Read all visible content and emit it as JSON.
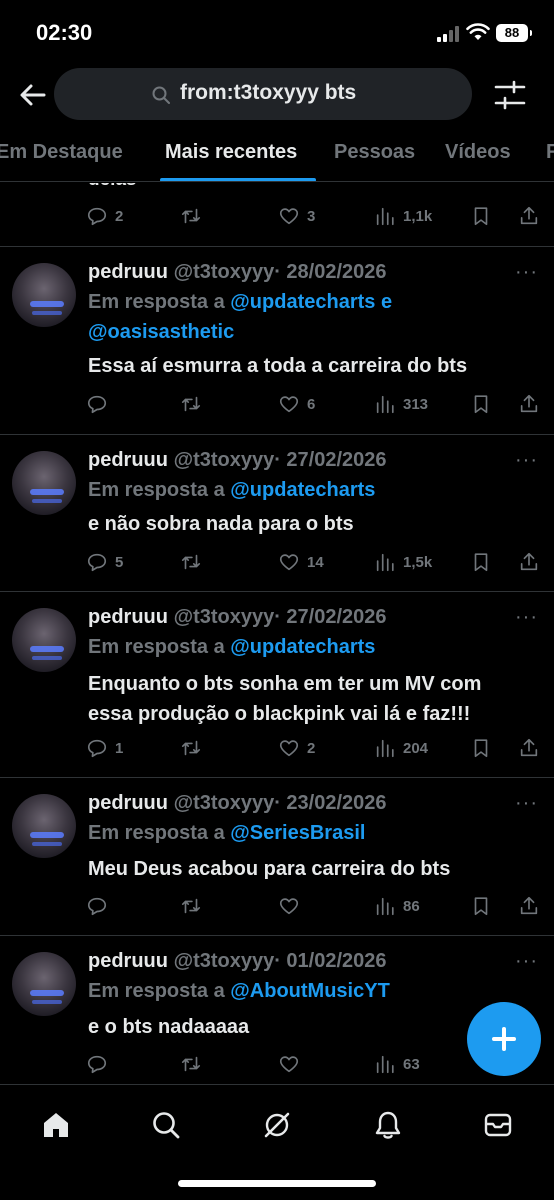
{
  "status_bar": {
    "time": "02:30",
    "battery": "88"
  },
  "search": {
    "query": "from:t3toxyyy bts"
  },
  "tabs": [
    {
      "label": "Em Destaque",
      "active": false
    },
    {
      "label": "Mais recentes",
      "active": true
    },
    {
      "label": "Pessoas",
      "active": false
    },
    {
      "label": "Vídeos",
      "active": false
    },
    {
      "label": "F",
      "active": false
    }
  ],
  "partial_tweet": {
    "text": "delas",
    "replies": "2",
    "likes": "3",
    "views": "1,1k"
  },
  "tweets": [
    {
      "name": "pedruuu",
      "handle": "@t3toxyyy",
      "date": "· 28/02/2026",
      "reply_prefix": "Em resposta a",
      "mention_1": "@updatecharts",
      "reply_and": "e",
      "mention_2": "@oasisasthetic",
      "text": "Essa aí esmurra a toda a carreira do bts",
      "replies": "",
      "likes": "6",
      "views": "313"
    },
    {
      "name": "pedruuu",
      "handle": "@t3toxyyy",
      "date": "· 27/02/2026",
      "reply_prefix": "Em resposta a",
      "mention_1": "@updatecharts",
      "text": "e não sobra nada para o bts",
      "replies": "5",
      "likes": "14",
      "views": "1,5k"
    },
    {
      "name": "pedruuu",
      "handle": "@t3toxyyy",
      "date": "· 27/02/2026",
      "reply_prefix": "Em resposta a",
      "mention_1": "@updatecharts",
      "text": "Enquanto o bts sonha em ter um MV com essa produção o blackpink vai lá e faz!!!",
      "replies": "1",
      "likes": "2",
      "views": "204"
    },
    {
      "name": "pedruuu",
      "handle": "@t3toxyyy",
      "date": "· 23/02/2026",
      "reply_prefix": "Em resposta a",
      "mention_1": "@SeriesBrasil",
      "text": "Meu Deus acabou para carreira do bts",
      "replies": "",
      "likes": "",
      "views": "86"
    },
    {
      "name": "pedruuu",
      "handle": "@t3toxyyy",
      "date": "· 01/02/2026",
      "reply_prefix": "Em resposta a",
      "mention_1": "@AboutMusicYT",
      "text": "e o bts nadaaaaa",
      "replies": "",
      "likes": "",
      "views": "63"
    }
  ],
  "more_glyph": "···",
  "colors": {
    "accent": "#1d9bf0",
    "muted": "#71767b",
    "background": "#000000"
  },
  "icons": [
    "back-arrow-icon",
    "search-icon",
    "filter-sliders-icon",
    "reply-icon",
    "retweet-icon",
    "like-icon",
    "views-icon",
    "bookmark-icon",
    "share-icon",
    "compose-plus-icon",
    "home-icon",
    "explore-icon",
    "grok-icon",
    "notifications-icon",
    "messages-icon"
  ]
}
